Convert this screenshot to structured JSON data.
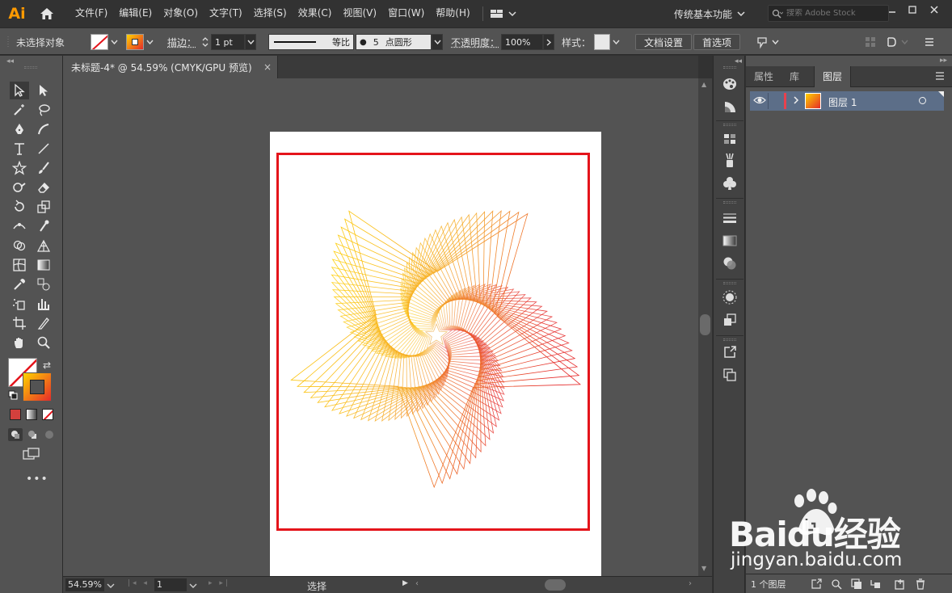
{
  "app": {
    "logo": "Ai"
  },
  "menu": {
    "items": [
      "文件(F)",
      "编辑(E)",
      "对象(O)",
      "文字(T)",
      "选择(S)",
      "效果(C)",
      "视图(V)",
      "窗口(W)",
      "帮助(H)"
    ]
  },
  "workspace": {
    "label": "传统基本功能"
  },
  "search": {
    "placeholder": "搜索 Adobe Stock"
  },
  "control": {
    "selection_status": "未选择对象",
    "stroke_label": "描边：",
    "stroke_weight": "1 pt",
    "stroke_profile": "等比",
    "brush_size": "5",
    "brush_name": "点圆形",
    "opacity_label": "不透明度：",
    "opacity_value": "100%",
    "style_label": "样式：",
    "doc_setup_button": "文档设置",
    "preferences_button": "首选项"
  },
  "document": {
    "tab_title": "未标题-4* @ 54.59% (CMYK/GPU 预览)",
    "close_glyph": "×"
  },
  "status": {
    "zoom": "54.59%",
    "artboard": "1",
    "tool": "选择"
  },
  "panel": {
    "tabs": [
      "属性",
      "库",
      "图层"
    ],
    "active_tab": "图层",
    "layer_name": "图层 1",
    "layer_count": "1 个图层"
  },
  "watermark": {
    "brand": "Baidu经验",
    "url": "jingyan.baidu.com"
  },
  "colors": {
    "menubar": "#323232",
    "panel": "#535353",
    "canvas": "#535353",
    "artboard_frame": "#e4141b",
    "layer_color": "#e8414d",
    "gradient_start": "#ffd400",
    "gradient_end": "#e52a2a",
    "logo": "#ff9a00"
  }
}
